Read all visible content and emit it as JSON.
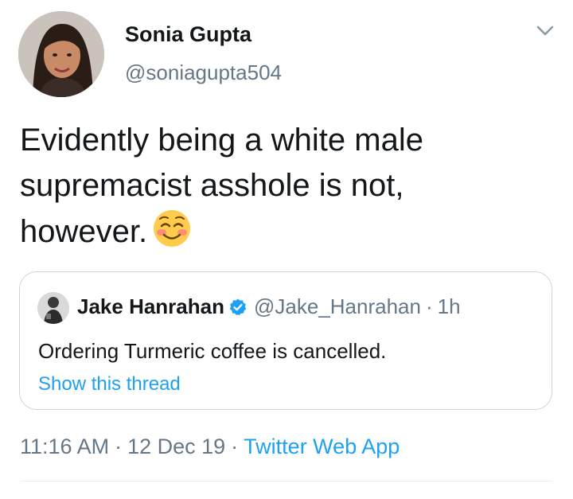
{
  "tweet": {
    "author": {
      "name": "Sonia Gupta",
      "handle": "@soniagupta504",
      "avatar_icon": "profile-photo-woman"
    },
    "menu_icon": "chevron-down-icon",
    "text": "Evidently being a white male supremacist asshole is not, however.",
    "emoji": "smiling-face-with-blush",
    "quoted": {
      "name": "Jake Hanrahan",
      "verified": true,
      "handle": "@Jake_Hanrahan",
      "separator": "·",
      "time": "1h",
      "text": "Ordering Turmeric coffee is cancelled.",
      "thread_link": "Show this thread"
    },
    "meta": {
      "time": "11:16 AM",
      "separator": "·",
      "date": "12 Dec 19",
      "source": "Twitter Web App"
    },
    "colors": {
      "link_blue": "#1da1f2",
      "muted_gray": "#657786",
      "border": "#ccd6dd"
    }
  }
}
